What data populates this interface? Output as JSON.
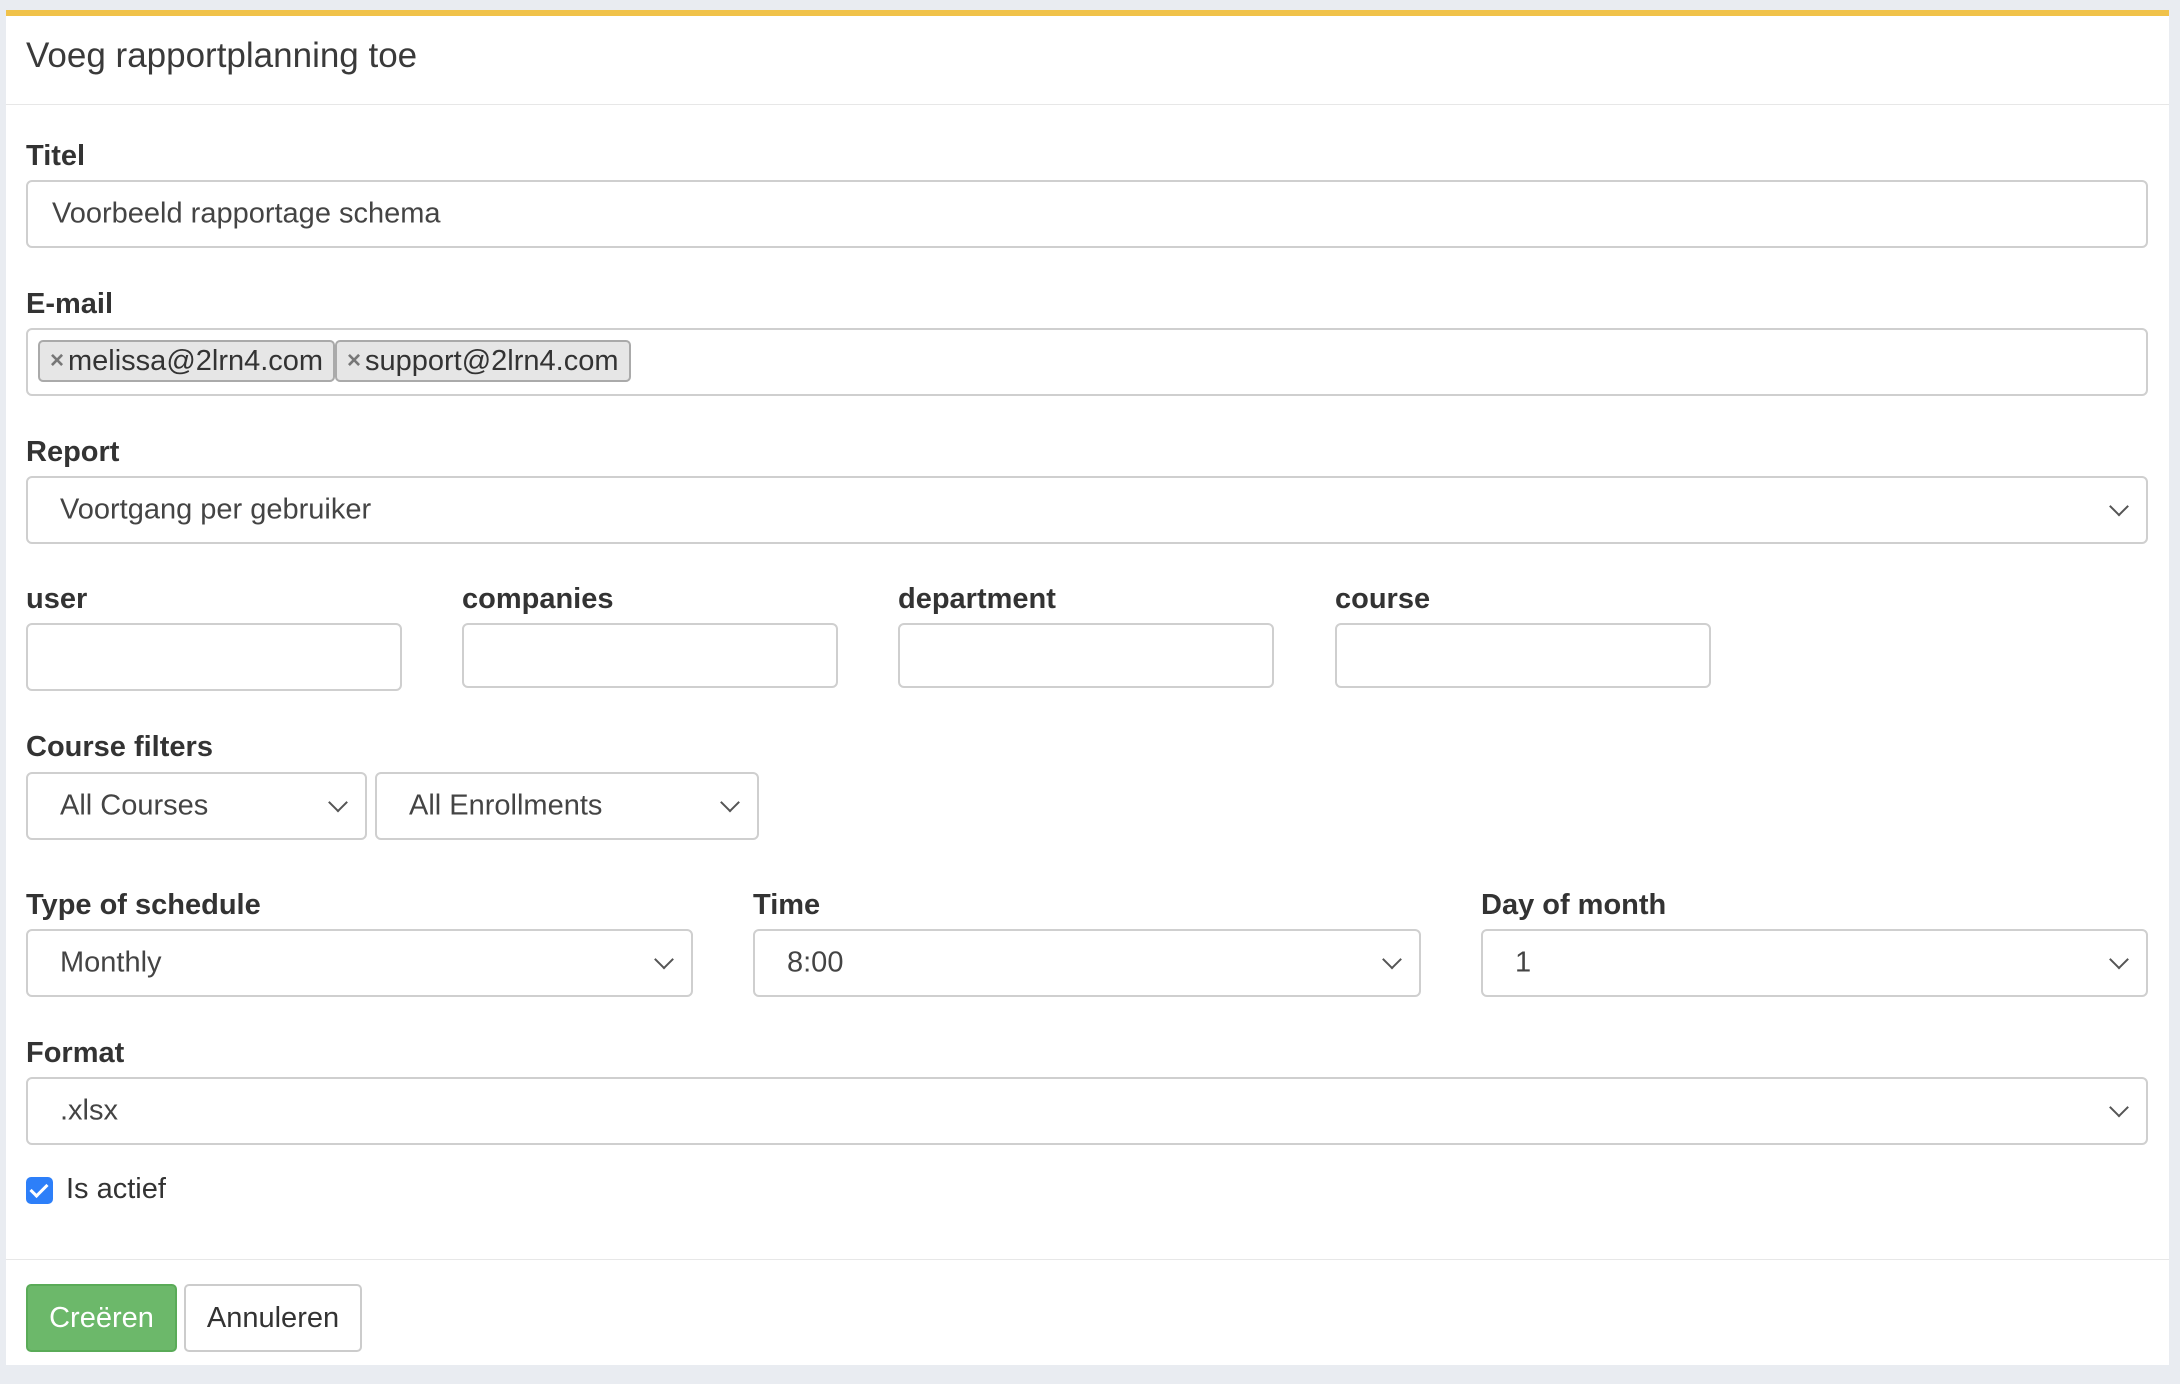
{
  "dialog": {
    "title": "Voeg rapportplanning toe"
  },
  "form": {
    "title_label": "Titel",
    "title_value": "Voorbeeld rapportage schema",
    "email_label": "E-mail",
    "emails": [
      "melissa@2lrn4.com",
      "support@2lrn4.com"
    ],
    "remove_symbol": "×",
    "report_label": "Report",
    "report_value": "Voortgang per gebruiker",
    "filters": {
      "user_label": "user",
      "companies_label": "companies",
      "department_label": "department",
      "course_label": "course"
    },
    "course_filters_label": "Course filters",
    "course_filter_value": "All Courses",
    "enrollment_filter_value": "All Enrollments",
    "schedule_type_label": "Type of schedule",
    "schedule_type_value": "Monthly",
    "time_label": "Time",
    "time_value": "8:00",
    "day_label": "Day of month",
    "day_value": "1",
    "format_label": "Format",
    "format_value": ".xlsx",
    "active_label": "Is actief",
    "active_checked": true
  },
  "buttons": {
    "create": "Creëren",
    "cancel": "Annuleren"
  },
  "colors": {
    "accent_top": "#f0c24a",
    "primary": "#6cb86a",
    "checkbox": "#2d7ff9"
  }
}
